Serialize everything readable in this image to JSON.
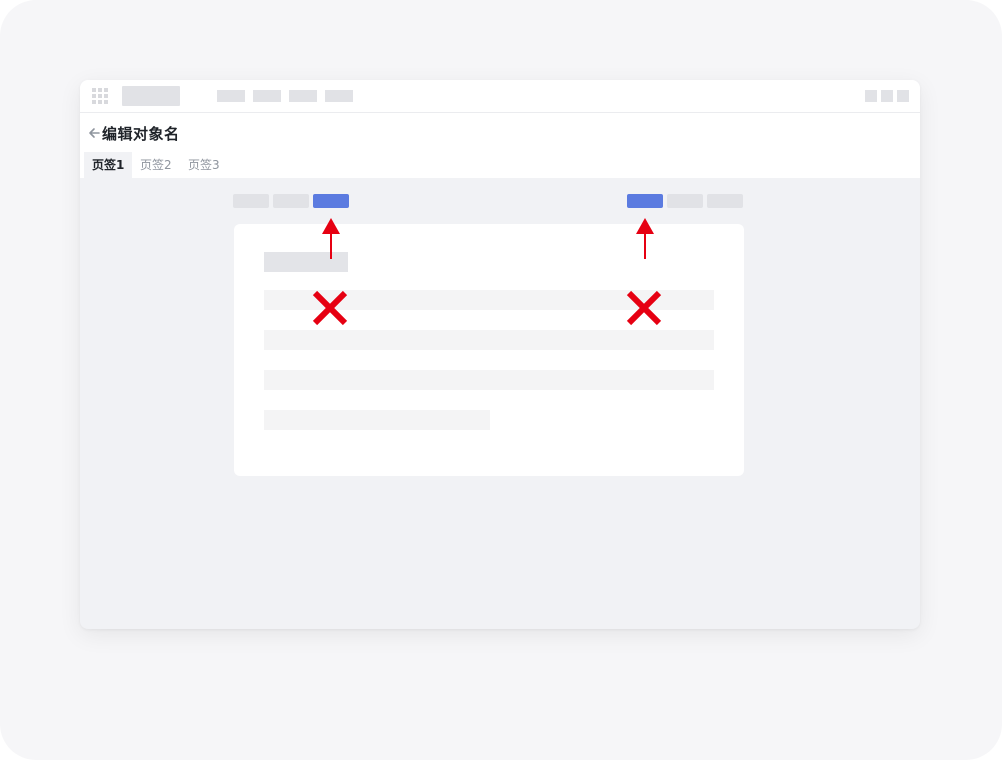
{
  "header": {
    "title": "编辑对象名"
  },
  "tabs": [
    {
      "label": "页签1",
      "active": true
    },
    {
      "label": "页签2",
      "active": false
    },
    {
      "label": "页签3",
      "active": false
    }
  ],
  "colors": {
    "primary": "#5b7be0",
    "annotation": "#e60012",
    "placeholder": "#e1e2e6"
  },
  "icons": {
    "app_menu": "grid-icon",
    "back": "arrow-left-icon",
    "annotation_arrow": "arrow-up-icon",
    "annotation_cross": "cross-icon"
  }
}
